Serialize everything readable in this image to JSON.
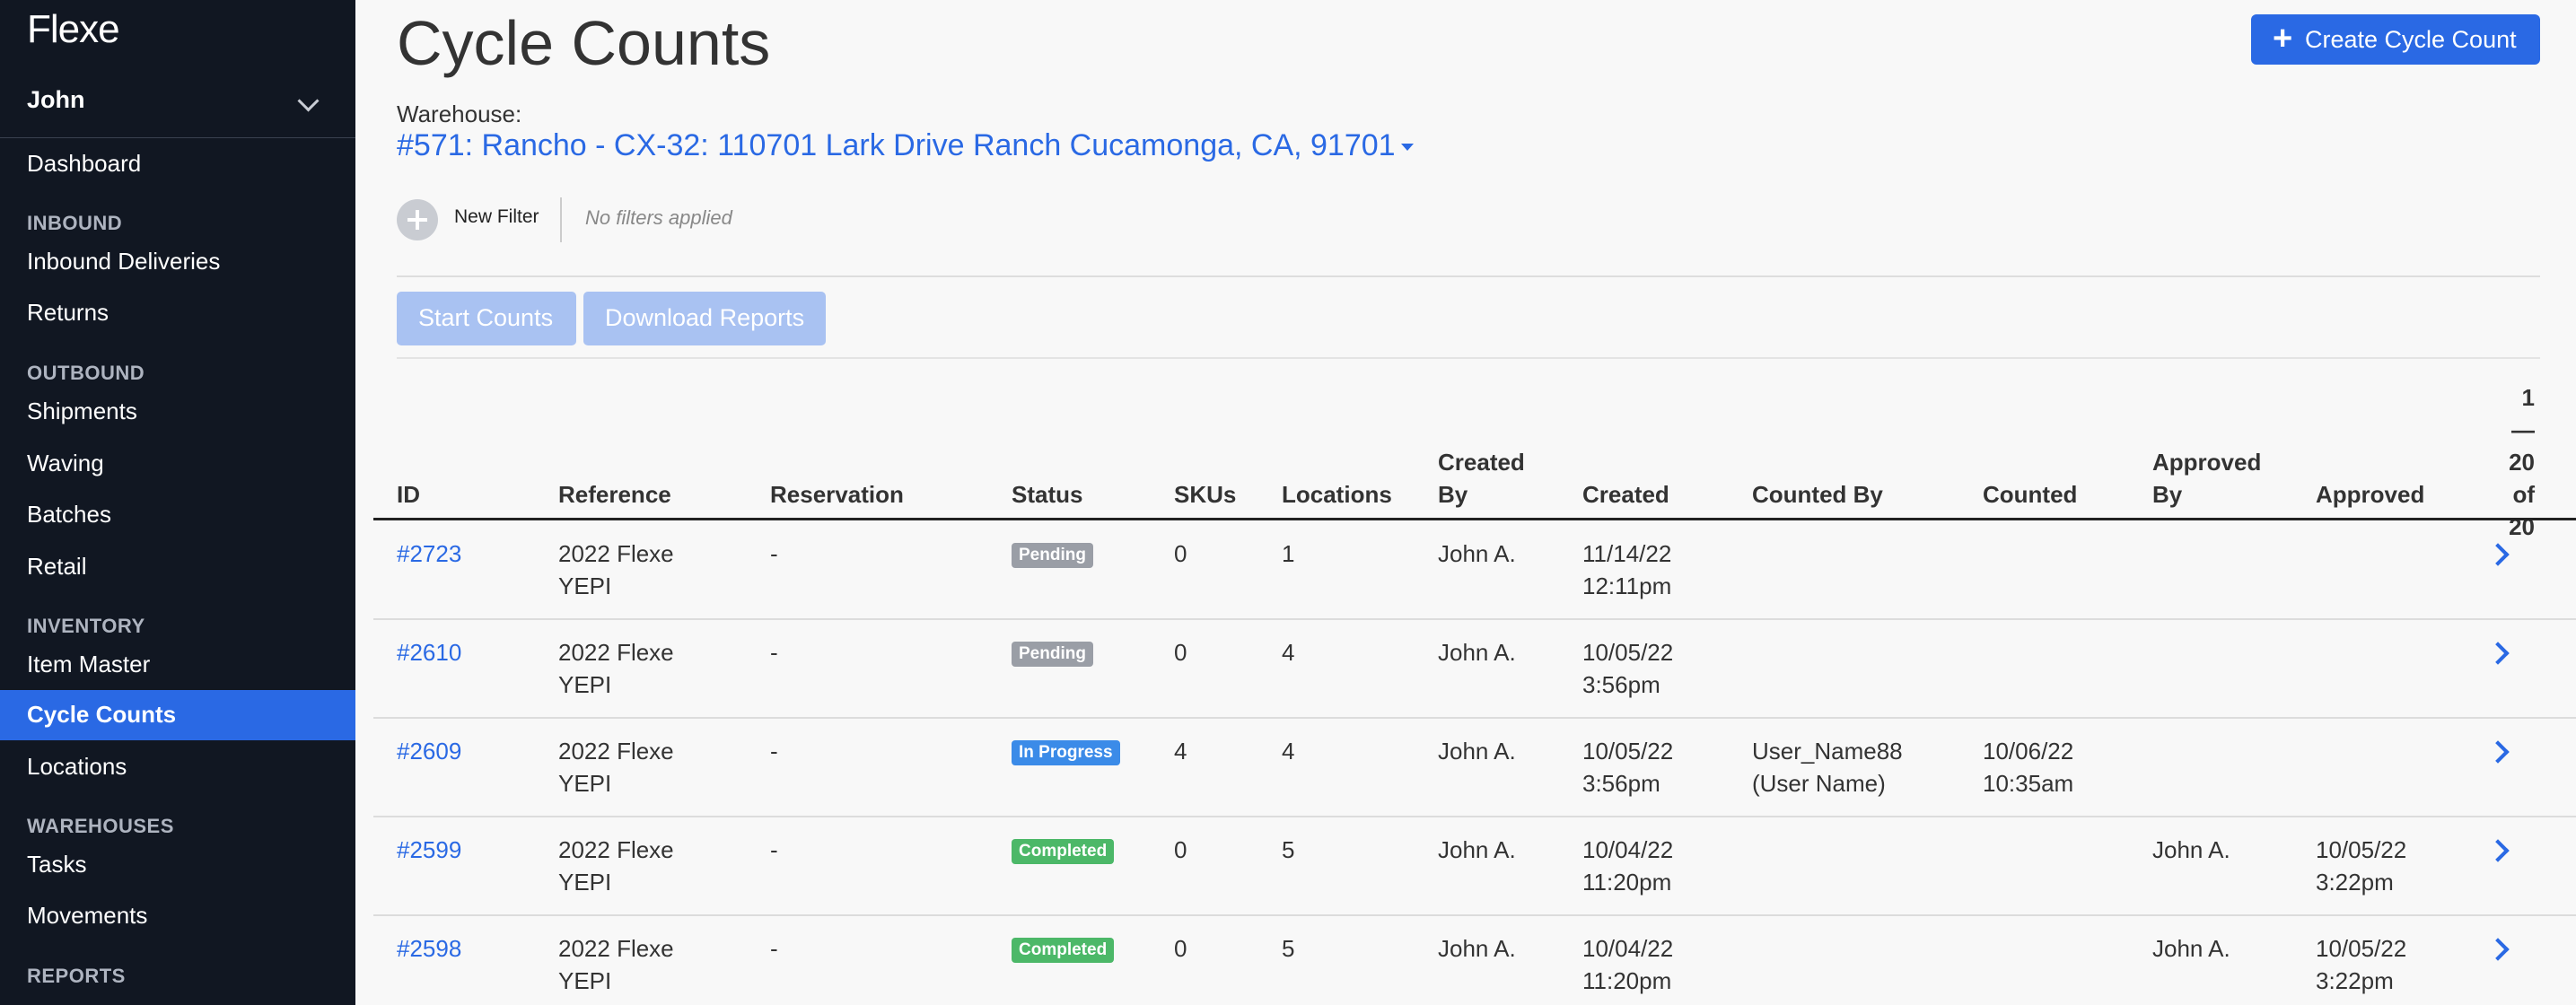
{
  "app": {
    "logo": "Flexe",
    "user": "John"
  },
  "sidebar": {
    "top_items": [
      {
        "label": "Dashboard"
      }
    ],
    "sections": [
      {
        "title": "INBOUND",
        "items": [
          "Inbound Deliveries",
          "Returns"
        ]
      },
      {
        "title": "OUTBOUND",
        "items": [
          "Shipments",
          "Waving",
          "Batches",
          "Retail"
        ]
      },
      {
        "title": "INVENTORY",
        "items": [
          "Item Master",
          "Cycle Counts",
          "Locations"
        ]
      },
      {
        "title": "WAREHOUSES",
        "items": [
          "Tasks",
          "Movements"
        ]
      },
      {
        "title": "REPORTS",
        "items": []
      }
    ],
    "active_item": "Cycle Counts"
  },
  "page": {
    "title": "Cycle Counts",
    "create_button": "Create Cycle Count",
    "warehouse_label": "Warehouse:",
    "warehouse_value": "#571: Rancho - CX-32: 110701 Lark Drive Ranch Cucamonga, CA, 91701",
    "new_filter": "New Filter",
    "no_filters": "No filters applied",
    "start_counts": "Start Counts",
    "download_reports": "Download Reports"
  },
  "table": {
    "columns": {
      "id": "ID",
      "reference": "Reference",
      "reservation": "Reservation",
      "status": "Status",
      "skus": "SKUs",
      "locations": "Locations",
      "created_by": [
        "Created",
        "By"
      ],
      "created": "Created",
      "counted_by": "Counted By",
      "counted": "Counted",
      "approved_by": [
        "Approved",
        "By"
      ],
      "approved": "Approved",
      "pagination": [
        "1—",
        "20",
        "of",
        "20"
      ]
    },
    "rows": [
      {
        "id": "#2723",
        "reference": [
          "2022 Flexe",
          "YEPI"
        ],
        "reservation": "-",
        "status": "Pending",
        "skus": "0",
        "locations": "1",
        "created_by": "John A.",
        "created": [
          "11/14/22",
          "12:11pm"
        ],
        "counted_by": [
          "",
          ""
        ],
        "counted": [
          "",
          ""
        ],
        "approved_by": "",
        "approved": [
          "",
          ""
        ]
      },
      {
        "id": "#2610",
        "reference": [
          "2022 Flexe",
          "YEPI"
        ],
        "reservation": "-",
        "status": "Pending",
        "skus": "0",
        "locations": "4",
        "created_by": "John A.",
        "created": [
          "10/05/22",
          "3:56pm"
        ],
        "counted_by": [
          "",
          ""
        ],
        "counted": [
          "",
          ""
        ],
        "approved_by": "",
        "approved": [
          "",
          ""
        ]
      },
      {
        "id": "#2609",
        "reference": [
          "2022 Flexe",
          "YEPI"
        ],
        "reservation": "-",
        "status": "In Progress",
        "skus": "4",
        "locations": "4",
        "created_by": "John A.",
        "created": [
          "10/05/22",
          "3:56pm"
        ],
        "counted_by": [
          "User_Name88",
          "(User Name)"
        ],
        "counted": [
          "10/06/22",
          "10:35am"
        ],
        "approved_by": "",
        "approved": [
          "",
          ""
        ]
      },
      {
        "id": "#2599",
        "reference": [
          "2022 Flexe",
          "YEPI"
        ],
        "reservation": "-",
        "status": "Completed",
        "skus": "0",
        "locations": "5",
        "created_by": "John A.",
        "created": [
          "10/04/22",
          "11:20pm"
        ],
        "counted_by": [
          "",
          ""
        ],
        "counted": [
          "",
          ""
        ],
        "approved_by": "John A.",
        "approved": [
          "10/05/22",
          "3:22pm"
        ]
      },
      {
        "id": "#2598",
        "reference": [
          "2022 Flexe",
          "YEPI"
        ],
        "reservation": "-",
        "status": "Completed",
        "skus": "0",
        "locations": "5",
        "created_by": "John A.",
        "created": [
          "10/04/22",
          "11:20pm"
        ],
        "counted_by": [
          "",
          ""
        ],
        "counted": [
          "",
          ""
        ],
        "approved_by": "John A.",
        "approved": [
          "10/05/22",
          "3:22pm"
        ]
      }
    ]
  },
  "colors": {
    "sidebar_bg": "#111722",
    "accent": "#2a69e4",
    "pending": "#9a9ea6",
    "in_progress": "#3b8be8",
    "completed": "#4cb868"
  }
}
